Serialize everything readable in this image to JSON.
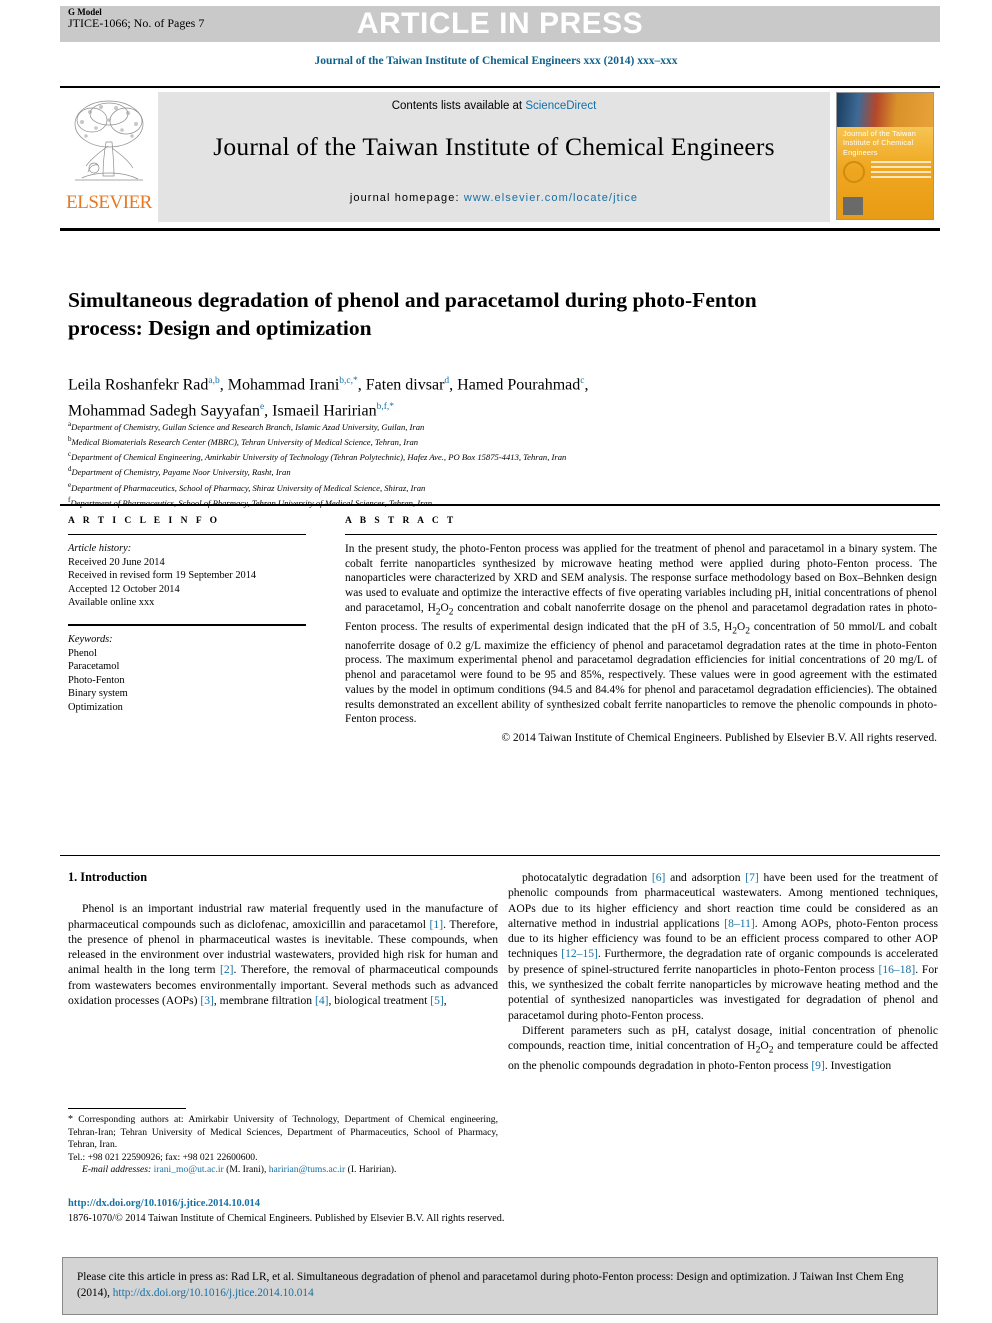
{
  "banner": {
    "press_label": "ARTICLE IN PRESS",
    "g_model": "G Model",
    "model_id": "JTICE-1066; No. of Pages 7"
  },
  "running_head": "Journal of the Taiwan Institute of Chemical Engineers xxx (2014) xxx–xxx",
  "masthead": {
    "contents_prefix": "Contents lists available at ",
    "contents_link": "ScienceDirect",
    "journal_title": "Journal of the Taiwan Institute of Chemical Engineers",
    "homepage_prefix": "journal homepage: ",
    "homepage_url": "www.elsevier.com/locate/jtice",
    "publisher_logo_word": "ELSEVIER",
    "cover_title": "Journal of the Taiwan Institute of Chemical Engineers"
  },
  "article": {
    "title": "Simultaneous degradation of phenol and paracetamol during photo-Fenton process: Design and optimization",
    "authors_line1_a": "Leila Roshanfekr Rad",
    "authors_line1_a_sup": "a,b",
    "authors_line1_b": "Mohammad Irani",
    "authors_line1_b_sup": "b,c,*",
    "authors_line1_c": "Faten divsar",
    "authors_line1_c_sup": "d",
    "authors_line1_d": "Hamed Pourahmad",
    "authors_line1_d_sup": "c",
    "authors_line2_a": "Mohammad Sadegh Sayyafan",
    "authors_line2_a_sup": "e",
    "authors_line2_b": "Ismaeil Haririan",
    "authors_line2_b_sup": "b,f,*",
    "affiliations": [
      {
        "mark": "a",
        "text": "Department of Chemistry, Guilan Science and Research Branch, Islamic Azad University, Guilan, Iran"
      },
      {
        "mark": "b",
        "text": "Medical Biomaterials Research Center (MBRC), Tehran University of Medical Science, Tehran, Iran"
      },
      {
        "mark": "c",
        "text": "Department of Chemical Engineering, Amirkabir University of Technology (Tehran Polytechnic), Hafez Ave., PO Box 15875-4413, Tehran, Iran"
      },
      {
        "mark": "d",
        "text": "Department of Chemistry, Payame Noor University, Rasht, Iran"
      },
      {
        "mark": "e",
        "text": "Department of Pharmaceutics, School of Pharmacy, Shiraz University of Medical Science, Shiraz, Iran"
      },
      {
        "mark": "f",
        "text": "Department of Pharmaceutics, School of Pharmacy, Tehran University of Medical Sciences, Tehran, Iran"
      }
    ]
  },
  "article_info": {
    "heading": "A R T I C L E   I N F O",
    "history_label": "Article history:",
    "history": [
      "Received 20 June 2014",
      "Received in revised form 19 September 2014",
      "Accepted 12 October 2014",
      "Available online xxx"
    ],
    "keywords_label": "Keywords:",
    "keywords": [
      "Phenol",
      "Paracetamol",
      "Photo-Fenton",
      "Binary system",
      "Optimization"
    ]
  },
  "abstract": {
    "heading": "A B S T R A C T",
    "text": "In the present study, the photo-Fenton process was applied for the treatment of phenol and paracetamol in a binary system. The cobalt ferrite nanoparticles synthesized by microwave heating method were applied during photo-Fenton process. The nanoparticles were characterized by XRD and SEM analysis. The response surface methodology based on Box–Behnken design was used to evaluate and optimize the interactive effects of five operating variables including pH, initial concentrations of phenol and paracetamol, H2O2 concentration and cobalt nanoferrite dosage on the phenol and paracetamol degradation rates in photo-Fenton process. The results of experimental design indicated that the pH of 3.5, H2O2 concentration of 50 mmol/L and cobalt nanoferrite dosage of 0.2 g/L maximize the efficiency of phenol and paracetamol degradation rates at the time in photo-Fenton process. The maximum experimental phenol and paracetamol degradation efficiencies for initial concentrations of 20 mg/L of phenol and paracetamol were found to be 95 and 85%, respectively. These values were in good agreement with the estimated values by the model in optimum conditions (94.5 and 84.4% for phenol and paracetamol degradation efficiencies). The obtained results demonstrated an excellent ability of synthesized cobalt ferrite nanoparticles to remove the phenolic compounds in photo-Fenton process.",
    "copyright": "© 2014 Taiwan Institute of Chemical Engineers. Published by Elsevier B.V. All rights reserved."
  },
  "body": {
    "section_heading": "1. Introduction",
    "left_paragraph": "Phenol is an important industrial raw material frequently used in the manufacture of pharmaceutical compounds such as diclofenac, amoxicillin and paracetamol [1]. Therefore, the presence of phenol in pharmaceutical wastes is inevitable. These compounds, when released in the environment over industrial wastewaters, provided high risk for human and animal health in the long term [2]. Therefore, the removal of pharmaceutical compounds from wastewaters becomes environmentally important. Several methods such as advanced oxidation processes (AOPs) [3], membrane filtration [4], biological treatment [5],",
    "right_paragraph_1": "photocatalytic degradation [6] and adsorption [7] have been used for the treatment of phenolic compounds from pharmaceutical wastewaters. Among mentioned techniques, AOPs due to its higher efficiency and short reaction time could be considered as an alternative method in industrial applications [8–11]. Among AOPs, photo-Fenton process due to its higher efficiency was found to be an efficient process compared to other AOP techniques [12–15]. Furthermore, the degradation rate of organic compounds is accelerated by presence of spinel-structured ferrite nanoparticles in photo-Fenton process [16–18]. For this, we synthesized the cobalt ferrite nanoparticles by microwave heating method and the potential of synthesized nanoparticles was investigated for degradation of phenol and paracetamol during photo-Fenton process.",
    "right_paragraph_2": "Different parameters such as pH, catalyst dosage, initial concentration of phenolic compounds, reaction time, initial concentration of H2O2 and temperature could be affected on the phenolic compounds degradation in photo-Fenton process [9]. Investigation"
  },
  "footnotes": {
    "corresponding": "Corresponding authors at: Amirkabir University of Technology, Department of Chemical engineering, Tehran-Iran; Tehran University of Medical Sciences, Department of Pharmaceutics, School of Pharmacy, Tehran, Iran.",
    "tel": "Tel.: +98 021 22590926; fax: +98 021 22600600.",
    "email_label": "E-mail addresses:",
    "email_1": "irani_mo@ut.ac.ir",
    "email_1_owner": "(M. Irani)",
    "email_2": "haririan@tums.ac.ir",
    "email_2_owner": "(I. Haririan)",
    "doi": "http://dx.doi.org/10.1016/j.jtice.2014.10.014",
    "copyright_line": "1876-1070/© 2014 Taiwan Institute of Chemical Engineers. Published by Elsevier B.V. All rights reserved."
  },
  "cite_box": {
    "text_before": "Please cite this article in press as: Rad LR, et al. Simultaneous degradation of phenol and paracetamol during photo-Fenton process: Design and optimization. J Taiwan Inst Chem Eng (2014), ",
    "link": "http://dx.doi.org/10.1016/j.jtice.2014.10.014"
  },
  "colors": {
    "link_blue": "#1570a6",
    "header_blue": "#11628c",
    "elsevier_orange": "#E87722",
    "banner_grey": "#c9c9c9"
  }
}
